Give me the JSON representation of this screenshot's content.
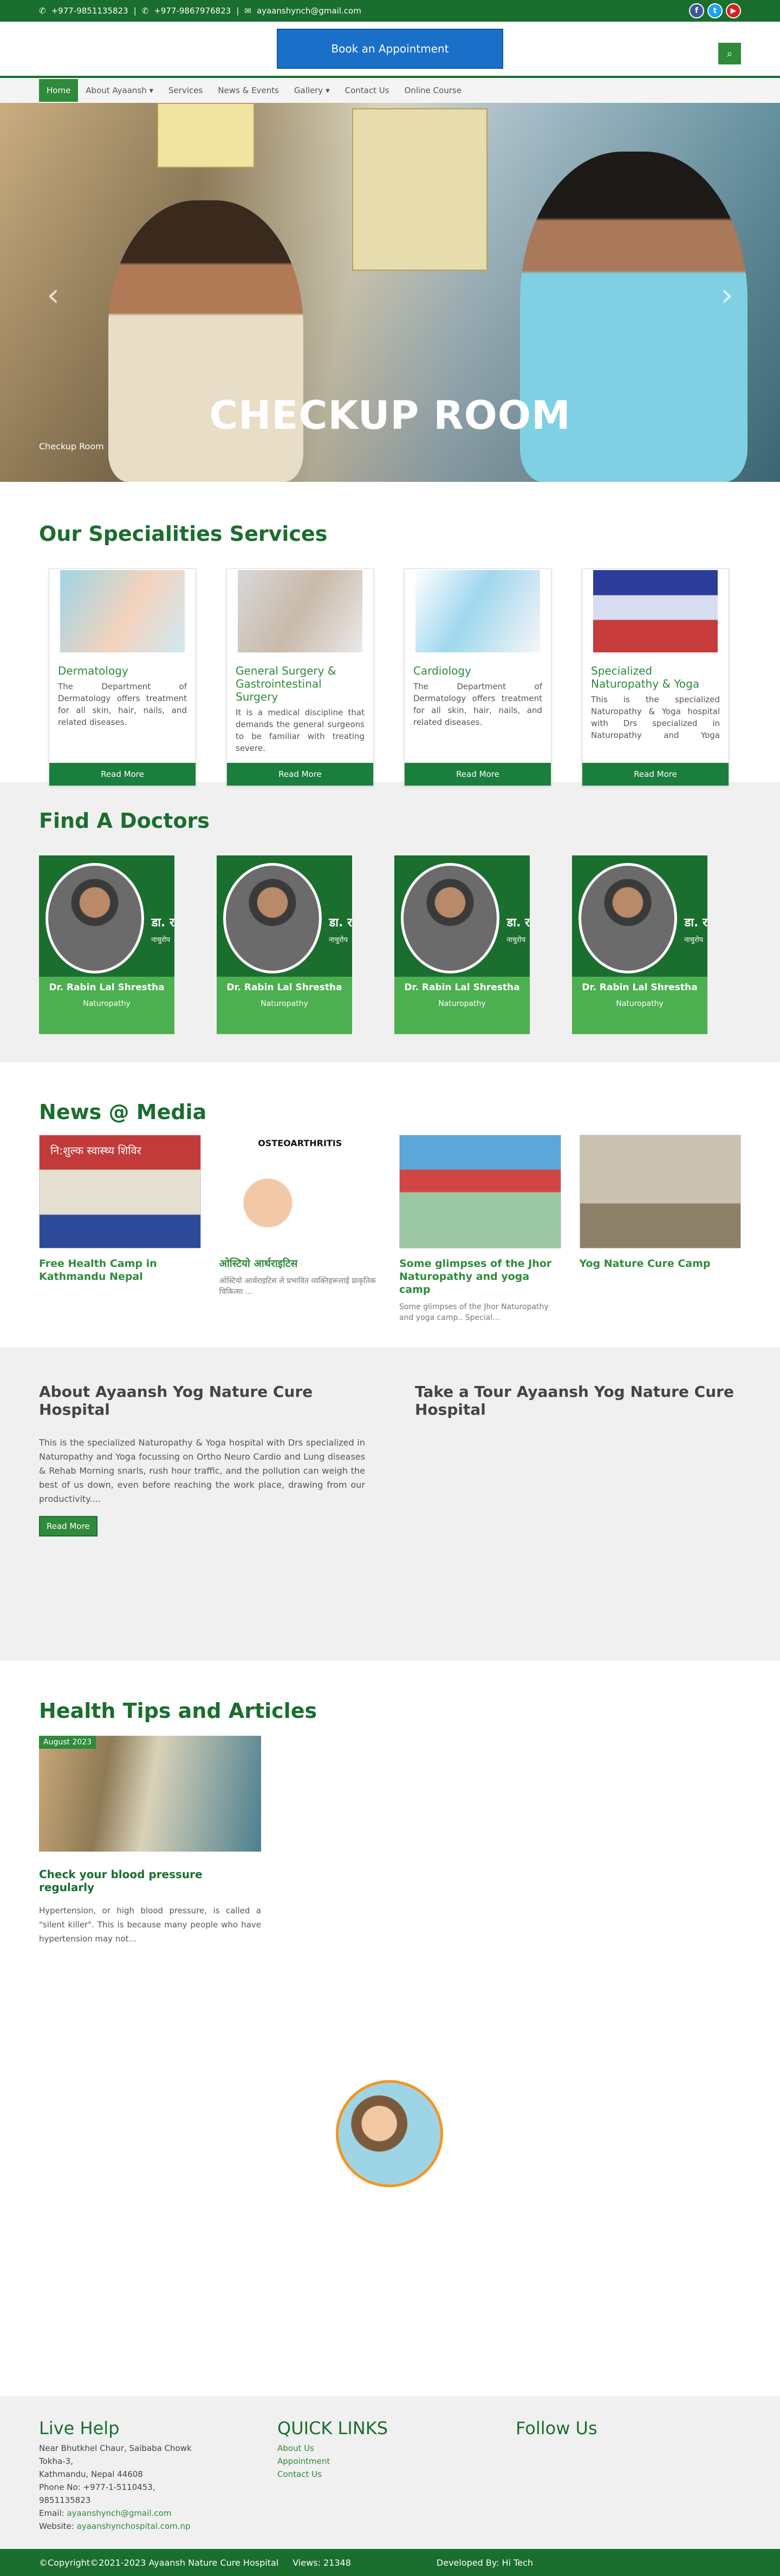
{
  "topbar": {
    "phone1": "+977-9851135823",
    "phone2": "+977-9867976823",
    "email": "ayaanshynch@gmail.com",
    "social": [
      {
        "name": "facebook-icon",
        "glyph": "f"
      },
      {
        "name": "twitter-icon",
        "glyph": "t"
      },
      {
        "name": "youtube-icon",
        "glyph": "▶"
      }
    ]
  },
  "header": {
    "appointment_label": "Book an Appointment",
    "search_glyph": "⌕"
  },
  "nav": {
    "items": [
      {
        "label": "Home",
        "active": true
      },
      {
        "label": "About Ayaansh ▾"
      },
      {
        "label": "Services"
      },
      {
        "label": "News & Events"
      },
      {
        "label": "Gallery ▾"
      },
      {
        "label": "Contact Us"
      },
      {
        "label": "Online Course"
      }
    ]
  },
  "hero": {
    "caption": "CHECKUP ROOM",
    "sub_caption": "Checkup Room"
  },
  "specialities": {
    "title": "Our Specialities Services",
    "read_more": "Read More",
    "cards": [
      {
        "title": "Dermatology",
        "text": "The Department of Dermatology offers treatment for all skin, hair, nails, and related diseases."
      },
      {
        "title": "General Surgery & Gastrointestinal Surgery",
        "text": "It is a medical discipline that demands the general surgeons to be familiar with treating severe."
      },
      {
        "title": "Cardiology",
        "text": "The Department of Dermatology offers treatment for all skin, hair, nails, and related diseases."
      },
      {
        "title": "Specialized Naturopathy & Yoga",
        "text": "This is the specialized Naturopathy & Yoga hospital with Drs specialized in Naturopathy and Yoga focussing on Ortho Neuro"
      }
    ]
  },
  "doctors": {
    "title": "Find A Doctors",
    "cards": [
      {
        "name": "Dr. Rabin Lal Shrestha",
        "dept": "Naturopathy",
        "badge": "डा. र",
        "badge2": "नाचुरोप"
      },
      {
        "name": "Dr. Rabin Lal Shrestha",
        "dept": "Naturopathy",
        "badge": "डा. र",
        "badge2": "नाचुरोप"
      },
      {
        "name": "Dr. Rabin Lal Shrestha",
        "dept": "Naturopathy",
        "badge": "डा. र",
        "badge2": "नाचुरोप"
      },
      {
        "name": "Dr. Rabin Lal Shrestha",
        "dept": "Naturopathy",
        "badge": "डा. र",
        "badge2": "नाचुरोप"
      }
    ]
  },
  "news": {
    "title": "News @ Media",
    "items": [
      {
        "title": "Free Health Camp in Kathmandu Nepal",
        "text": "",
        "img_label": "नि:शुल्क स्वास्थ्य शिविर"
      },
      {
        "title": "ओस्टियो आर्थराइटिस",
        "text": "ओस्टियो आर्थराइटिस ले प्रभावित व्यक्तिहरूलाई प्राकृतिक चिकित्सा ...",
        "img_label": "OSTEOARTHRITIS"
      },
      {
        "title": "Some glimpses of the Jhor Naturopathy and yoga camp",
        "text": "Some glimpses of the Jhor Naturopathy and yoga camp.. Special...",
        "img_label": ""
      },
      {
        "title": "Yog Nature Cure Camp",
        "text": "",
        "img_label": ""
      }
    ]
  },
  "about": {
    "title": "About Ayaansh Yog Nature Cure Hospital",
    "text": "This is the specialized Naturopathy & Yoga hospital with Drs specialized in Naturopathy and Yoga focussing on Ortho Neuro Cardio and Lung diseases & Rehab Morning snarls, rush hour traffic, and the pollution can weigh the best of us down, even before reaching the work place, drawing from our productivity....",
    "read_more": "Read More",
    "tour_title": "Take a Tour Ayaansh Yog Nature Cure Hospital"
  },
  "tips": {
    "title": "Health Tips and Articles",
    "card": {
      "date": "August 2023",
      "title": "Check your blood pressure regularly",
      "text": "Hypertension, or high blood pressure, is called a \"silent killer\". This is because many people who have hypertension may not..."
    }
  },
  "footer": {
    "live_help": {
      "title": "Live Help",
      "address1": "Near Bhutkhel Chaur, Saibaba Chowk Tokha-3,",
      "address2": "Kathmandu, Nepal 44608",
      "phone": "Phone No: +977-1-5110453, 9851135823",
      "email_label": "Email:",
      "email": "ayaanshynch@gmail.com",
      "website_label": "Website:",
      "website": "ayaanshynchospital.com.np"
    },
    "quick_links": {
      "title": "QUICK LINKS",
      "links": [
        "About Us",
        "Appointment",
        "Contact Us"
      ]
    },
    "follow": {
      "title": "Follow Us"
    }
  },
  "copyright": {
    "text": "©Copyright©2021-2023 Ayaansh Nature Cure Hospital",
    "views": "Views: 21348",
    "developer": "Developed By: Hi Tech"
  },
  "colors": {
    "primary_green": "#1a6e2e",
    "accent_green": "#2f8a3b",
    "button_blue": "#1a6fc9"
  }
}
